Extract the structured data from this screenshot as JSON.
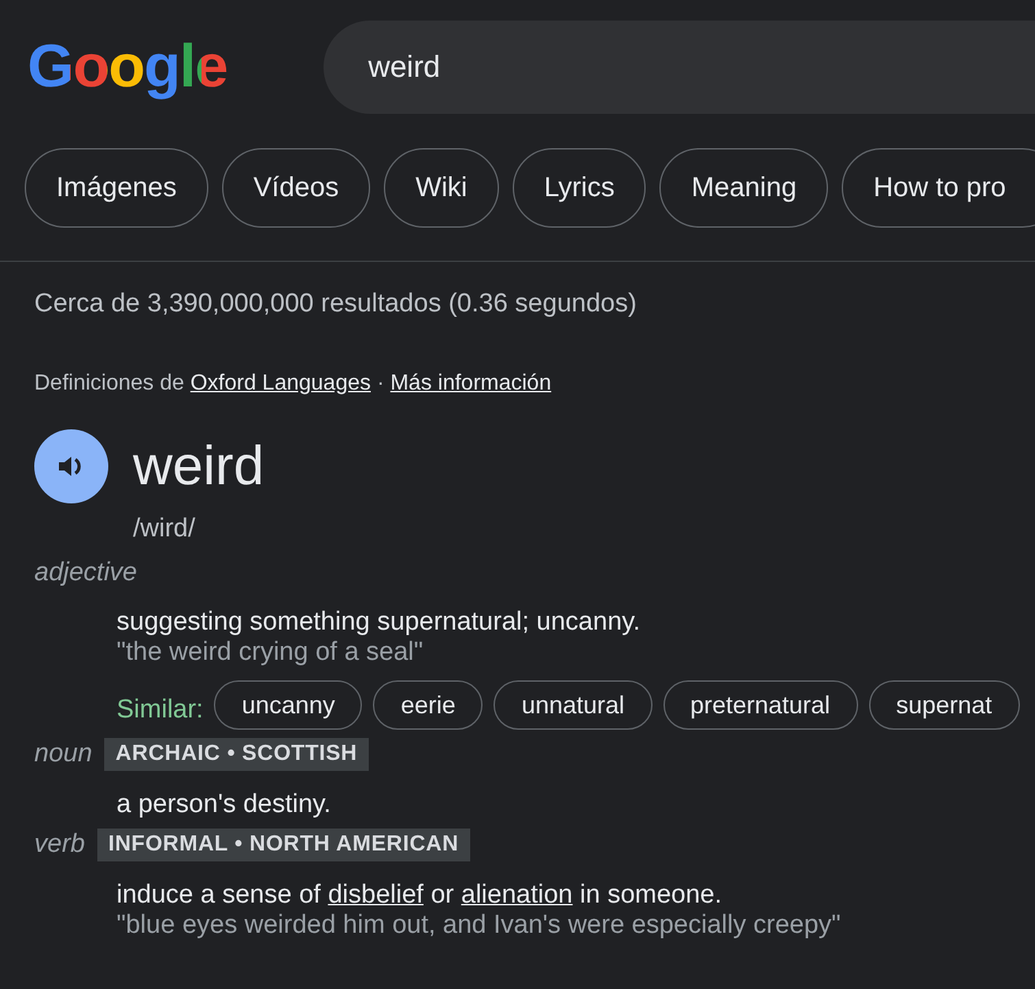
{
  "header": {
    "logo": "Google",
    "query": "weird"
  },
  "chips": [
    {
      "label": "Imágenes"
    },
    {
      "label": "Vídeos"
    },
    {
      "label": "Wiki"
    },
    {
      "label": "Lyrics"
    },
    {
      "label": "Meaning"
    },
    {
      "label": "How to pro"
    }
  ],
  "results_count": "Cerca de 3,390,000,000 resultados (0.36 segundos)",
  "source": [
    {
      "kind": "text",
      "text": "Definiciones de "
    },
    {
      "kind": "link",
      "text": "Oxford Languages"
    },
    {
      "kind": "text",
      "text": " · "
    },
    {
      "kind": "link",
      "text": "Más información"
    }
  ],
  "entry": {
    "word": "weird",
    "phonetic": "/wird/"
  },
  "senses": [
    {
      "pos": "adjective",
      "definition": [
        {
          "kind": "text",
          "text": "suggesting something supernatural; uncanny."
        }
      ],
      "example": "\"the weird crying of a seal\"",
      "similar_label": "Similar:",
      "similar": [
        "uncanny",
        "eerie",
        "unnatural",
        "preternatural",
        "supernat"
      ]
    },
    {
      "pos": "noun",
      "tag": "ARCHAIC • SCOTTISH",
      "definition": [
        {
          "kind": "text",
          "text": "a person's destiny."
        }
      ]
    },
    {
      "pos": "verb",
      "tag": "INFORMAL • NORTH AMERICAN",
      "definition": [
        {
          "kind": "text",
          "text": "induce a sense of "
        },
        {
          "kind": "link",
          "text": "disbelief"
        },
        {
          "kind": "text",
          "text": " or "
        },
        {
          "kind": "link",
          "text": "alienation"
        },
        {
          "kind": "text",
          "text": " in someone."
        }
      ],
      "example": "\"blue eyes weirded him out, and Ivan's were especially creepy\""
    }
  ]
}
